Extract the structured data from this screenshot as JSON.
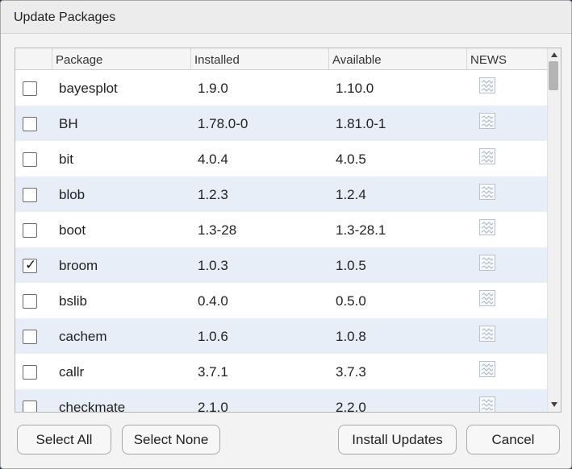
{
  "dialog": {
    "title": "Update Packages"
  },
  "columns": {
    "package": "Package",
    "installed": "Installed",
    "available": "Available",
    "news": "NEWS"
  },
  "rows": [
    {
      "package": "bayesplot",
      "installed": "1.9.0",
      "available": "1.10.0",
      "checked": false
    },
    {
      "package": "BH",
      "installed": "1.78.0-0",
      "available": "1.81.0-1",
      "checked": false
    },
    {
      "package": "bit",
      "installed": "4.0.4",
      "available": "4.0.5",
      "checked": false
    },
    {
      "package": "blob",
      "installed": "1.2.3",
      "available": "1.2.4",
      "checked": false
    },
    {
      "package": "boot",
      "installed": "1.3-28",
      "available": "1.3-28.1",
      "checked": false
    },
    {
      "package": "broom",
      "installed": "1.0.3",
      "available": "1.0.5",
      "checked": true
    },
    {
      "package": "bslib",
      "installed": "0.4.0",
      "available": "0.5.0",
      "checked": false
    },
    {
      "package": "cachem",
      "installed": "1.0.6",
      "available": "1.0.8",
      "checked": false
    },
    {
      "package": "callr",
      "installed": "3.7.1",
      "available": "3.7.3",
      "checked": false
    },
    {
      "package": "checkmate",
      "installed": "2.1.0",
      "available": "2.2.0",
      "checked": false
    }
  ],
  "buttons": {
    "select_all": "Select All",
    "select_none": "Select None",
    "install_updates": "Install Updates",
    "cancel": "Cancel"
  },
  "icons": {
    "news": "news-document-icon",
    "check": "checkmark-icon"
  },
  "colors": {
    "row_alt": "#e8eef7",
    "row": "#ffffff"
  }
}
